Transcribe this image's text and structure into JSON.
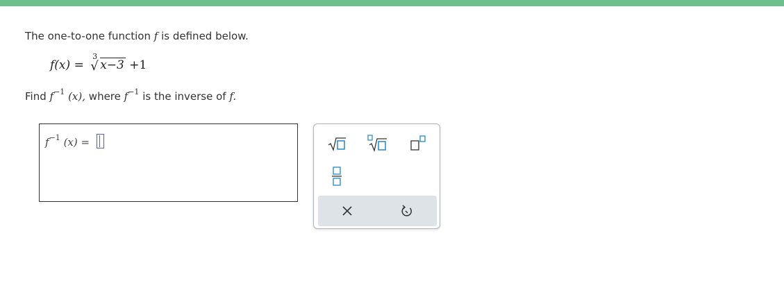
{
  "problem": {
    "intro_text": "The one-to-one function",
    "intro_func": "f",
    "intro_suffix": "is defined below.",
    "formula": {
      "lhs": "f(x)",
      "equals": "=",
      "root_index": "3",
      "radicand": "x−3",
      "tail": "+1"
    },
    "find_prefix": "Find",
    "find_func": "f",
    "find_exp": "−1",
    "find_arg": "(x),",
    "where_text": "where",
    "where_func": "f",
    "where_exp": "−1",
    "inverse_text": "is the inverse of",
    "inverse_func": "f."
  },
  "answer": {
    "func": "f",
    "exp": "−1",
    "arg": "(x)",
    "equals": "="
  },
  "tools": {
    "sqrt_icon": "square-root-icon",
    "nthroot_icon": "nth-root-icon",
    "superscript_icon": "superscript-icon",
    "fraction_icon": "fraction-icon",
    "clear_icon": "clear-x-icon",
    "undo_icon": "undo-icon"
  },
  "colors": {
    "top_bar": "#6cc08b",
    "tool_accent": "#1f88c8",
    "cursor": "#5b5bd6",
    "tool_bar_bg": "#dde3e6"
  }
}
